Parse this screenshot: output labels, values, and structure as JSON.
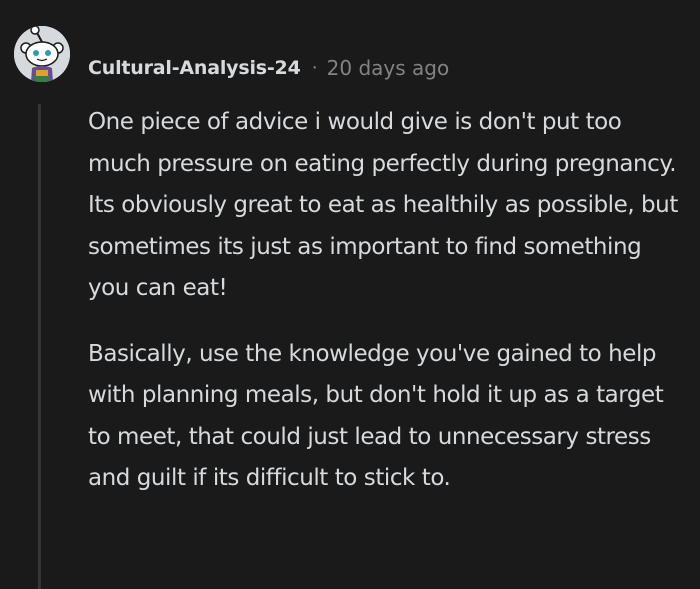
{
  "comment": {
    "author": "Cultural-Analysis-24",
    "separator": "·",
    "time_ago": "20 days ago",
    "avatar_icon": "snoo-avatar-icon",
    "paragraphs": [
      "One piece of advice i would give is don't put too much pressure on eating perfectly during pregnancy. Its obviously great to eat as healthily as possible, but sometimes its just as important to find something you can eat!",
      "Basically, use the knowledge you've gained to help with planning meals, but don't hold it up as a target to meet, that could just lead to unnecessary stress and guilt if its difficult to stick to."
    ]
  },
  "colors": {
    "background": "#1a1a1b",
    "text": "#d7dadc",
    "meta": "#818384",
    "thread_line": "#343536"
  }
}
